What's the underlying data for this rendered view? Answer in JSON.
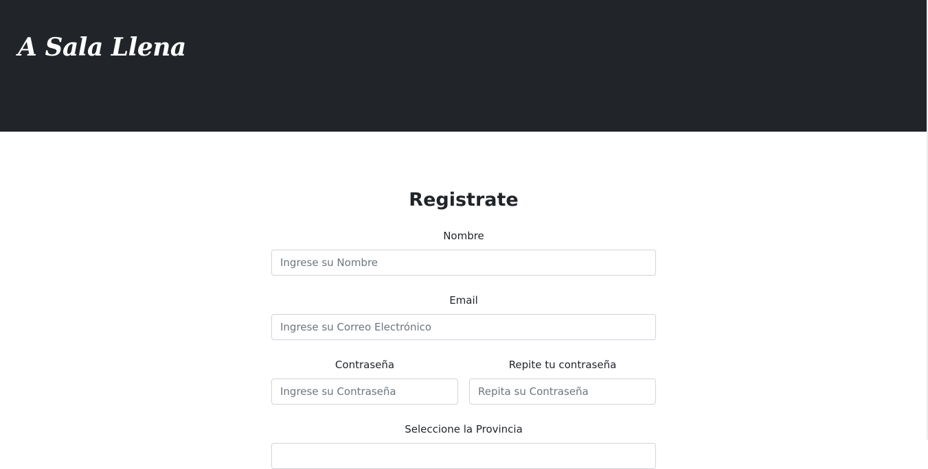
{
  "header": {
    "brand": "A Sala Llena"
  },
  "form": {
    "title": "Registrate",
    "nombre": {
      "label": "Nombre",
      "placeholder": "Ingrese su Nombre"
    },
    "email": {
      "label": "Email",
      "placeholder": "Ingrese su Correo Electrónico"
    },
    "password": {
      "label": "Contraseña",
      "placeholder": "Ingrese su Contraseña"
    },
    "password_repeat": {
      "label": "Repite tu contraseña",
      "placeholder": "Repita su Contraseña"
    },
    "provincia": {
      "label": "Seleccione la Provincia"
    }
  },
  "colors": {
    "header_bg": "#212529",
    "input_border": "#ced4da",
    "text": "#212529"
  }
}
